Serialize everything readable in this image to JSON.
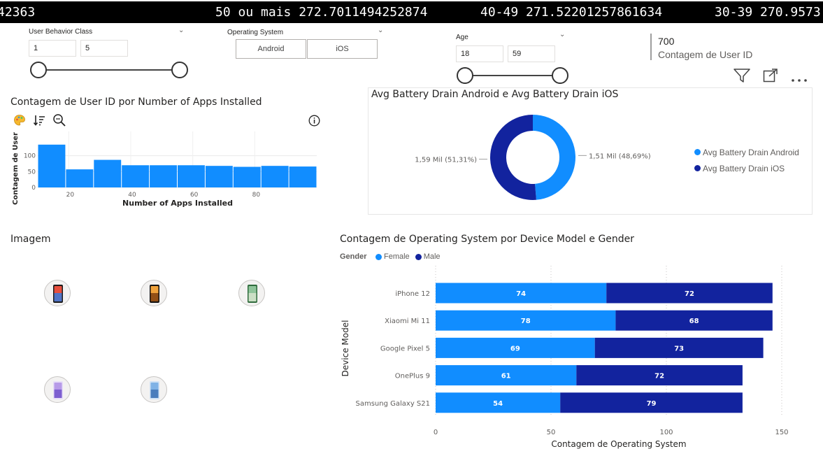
{
  "ticker": {
    "items": [
      "42363",
      "50 ou mais 272.7011494252874",
      "40-49 271.52201257861634",
      "30-39 270.9573"
    ]
  },
  "slicers": {
    "behavior": {
      "title": "User Behavior Class",
      "min": "1",
      "max": "5"
    },
    "os": {
      "title": "Operating System",
      "options": [
        "Android",
        "iOS"
      ]
    },
    "age": {
      "title": "Age",
      "min": "18",
      "max": "59"
    }
  },
  "card": {
    "value": "700",
    "label": "Contagem de User ID"
  },
  "histogram": {
    "title": "Contagem de User ID por Number of Apps Installed",
    "chart_data": {
      "type": "bar",
      "title": "Contagem de User ID por Number of Apps Installed",
      "xlabel": "Number of Apps Installed",
      "ylabel": "Contagem de User",
      "bins": [
        10,
        20,
        30,
        40,
        50,
        60,
        70,
        80,
        90,
        100
      ],
      "values": [
        135,
        57,
        87,
        70,
        70,
        70,
        68,
        65,
        68,
        66
      ],
      "xticks": [
        "20",
        "40",
        "60",
        "80"
      ],
      "yticks": [
        "0",
        "50",
        "100"
      ],
      "ylim": [
        0,
        150
      ],
      "color": "#118DFF"
    }
  },
  "donut": {
    "title": "Avg Battery Drain Android e Avg Battery Drain iOS",
    "chart_data": {
      "type": "pie",
      "title": "Avg Battery Drain Android e Avg Battery Drain iOS",
      "labels": [
        "Avg Battery Drain Android",
        "Avg Battery Drain iOS"
      ],
      "values": [
        1.51,
        1.59
      ],
      "percent": [
        48.69,
        51.31
      ],
      "colors": [
        "#118DFF",
        "#12239E"
      ],
      "data_labels": [
        "1,51 Mil (48,69%)",
        "1,59 Mil (51,31%)"
      ]
    }
  },
  "images": {
    "title": "Imagem",
    "items": [
      {
        "name": "phone-image-1",
        "colors": [
          "#e84f3d",
          "#2b7de9",
          "#1a1a1a"
        ]
      },
      {
        "name": "phone-image-2",
        "colors": [
          "#f0a23b",
          "#7a3b0c",
          "#111111"
        ]
      },
      {
        "name": "phone-image-3",
        "colors": [
          "#8fc49a",
          "#d9e6d0",
          "#2f6b3c"
        ]
      },
      {
        "name": "phone-image-4",
        "colors": [
          "#b79be8",
          "#6e4fc9",
          "#e7def8"
        ]
      },
      {
        "name": "phone-image-5",
        "colors": [
          "#7fb2e6",
          "#3c6fb3",
          "#cfe2f6"
        ]
      }
    ]
  },
  "stacked": {
    "title": "Contagem de Operating System por Device Model e Gender",
    "legend_title": "Gender",
    "chart_data": {
      "type": "bar",
      "orientation": "horizontal",
      "stacked": true,
      "title": "Contagem de Operating System por Device Model e Gender",
      "xlabel": "Contagem de Operating System",
      "ylabel": "Device Model",
      "categories": [
        "iPhone 12",
        "Xiaomi Mi 11",
        "Google Pixel 5",
        "OnePlus 9",
        "Samsung Galaxy S21"
      ],
      "series": [
        {
          "name": "Female",
          "values": [
            74,
            78,
            69,
            61,
            54
          ],
          "color": "#118DFF"
        },
        {
          "name": "Male",
          "values": [
            72,
            68,
            73,
            72,
            79
          ],
          "color": "#12239E"
        }
      ],
      "xticks": [
        "0",
        "50",
        "100",
        "150"
      ],
      "xlim": [
        0,
        150
      ]
    }
  },
  "toolbar": {
    "icons": [
      "filter-icon",
      "focus-mode-icon",
      "more-options-icon"
    ]
  }
}
